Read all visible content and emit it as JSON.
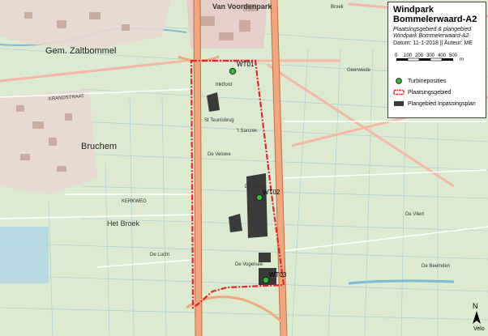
{
  "panel": {
    "title_line1": "Windpark",
    "title_line2": "Bommelerwaard-A2",
    "subtitle_line1": "Plaatsingsgebied & plangebied",
    "subtitle_line2": "Windpark Bommelerwaard-A2",
    "date_line": "Datum: 11-1-2018 || Auteur: ME",
    "scale_ticks": [
      "0",
      "100",
      "200",
      "300",
      "400",
      "500"
    ],
    "scale_unit": "m"
  },
  "legend": [
    {
      "label": "Turbineposities"
    },
    {
      "label": "Plaatsingsgebied"
    },
    {
      "label": "Plangebied Inpassingsplan"
    }
  ],
  "turbines": [
    "WT01",
    "WT02",
    "WT03"
  ],
  "places": {
    "zaltbommel": "Gem. Zaltbommel",
    "bruchem": "Bruchem",
    "voordenpark": "Van Voordenpark",
    "hetbroek": "Het Broek",
    "desnoei": "De Snoei",
    "develowe": "De Velowe",
    "delucht": "De Lucht",
    "geerweide": "Geerweide",
    "devliert": "De Vliert",
    "debeemden": "De Beemden",
    "broek": "Broek",
    "inktford": "Inktford",
    "teunisbrug": "St Teunisbrug",
    "sarcrek": "'t Sarcrek",
    "vogelsee": "De Vogelsee",
    "krandstraat": "KRANDSTRAAT",
    "kerkweg": "KERKWEG"
  },
  "north_label": "N",
  "credit": "Velo",
  "colors": {
    "boundary": "#e3242b",
    "plangebied": "#3a3a3a",
    "turbine": "#2ec02e",
    "road": "#f6b6a6",
    "water": "#aad3ea",
    "field": "#dcebd0"
  }
}
